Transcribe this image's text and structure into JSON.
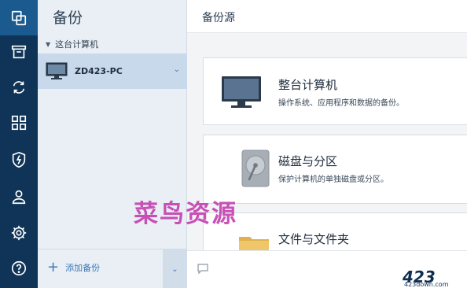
{
  "rail": {
    "items": [
      {
        "icon": "copy-icon",
        "active": true
      },
      {
        "icon": "archive-icon"
      },
      {
        "icon": "sync-icon"
      },
      {
        "icon": "dashboard-grid-icon"
      },
      {
        "icon": "shield-icon"
      },
      {
        "icon": "account-icon"
      },
      {
        "icon": "settings-gear-icon"
      },
      {
        "icon": "help-icon"
      }
    ]
  },
  "backup_list": {
    "title": "备份",
    "group_label": "这台计算机",
    "items": [
      {
        "name": "ZD423-PC"
      }
    ],
    "add_label": "添加备份"
  },
  "main": {
    "title": "备份源",
    "sources": [
      {
        "title": "整台计算机",
        "desc": "操作系统、应用程序和数据的备份。",
        "icon": "monitor-icon"
      },
      {
        "title": "磁盘与分区",
        "desc": "保护计算机的单独磁盘或分区。",
        "icon": "hard-disk-icon"
      },
      {
        "title": "文件与文件夹",
        "desc": "",
        "icon": "folder-icon"
      }
    ]
  },
  "watermark": "菜鸟资源",
  "logo": {
    "brand": "423",
    "site": "423down.com"
  },
  "colors": {
    "rail": "#0f3457",
    "rail_active": "#1a5a8f",
    "accent": "#3c79b8",
    "selected_item": "#c7d9ea"
  }
}
